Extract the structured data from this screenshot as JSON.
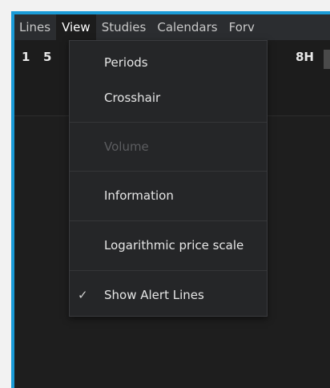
{
  "menubar": {
    "items": [
      "Lines",
      "View",
      "Studies",
      "Calendars",
      "Forv"
    ],
    "active": "View"
  },
  "toolbar": {
    "period_1": "1",
    "period_5": "5",
    "period_8h": "8H"
  },
  "view_menu": {
    "periods": "Periods",
    "crosshair": "Crosshair",
    "volume": "Volume",
    "information": "Information",
    "log_scale": "Logarithmic price scale",
    "show_alert_lines": "Show Alert Lines",
    "check_glyph": "✓"
  },
  "colors": {
    "frame_accent": "#1a9bd7",
    "menu_background": "#252628",
    "app_background": "#1e1e1e"
  }
}
